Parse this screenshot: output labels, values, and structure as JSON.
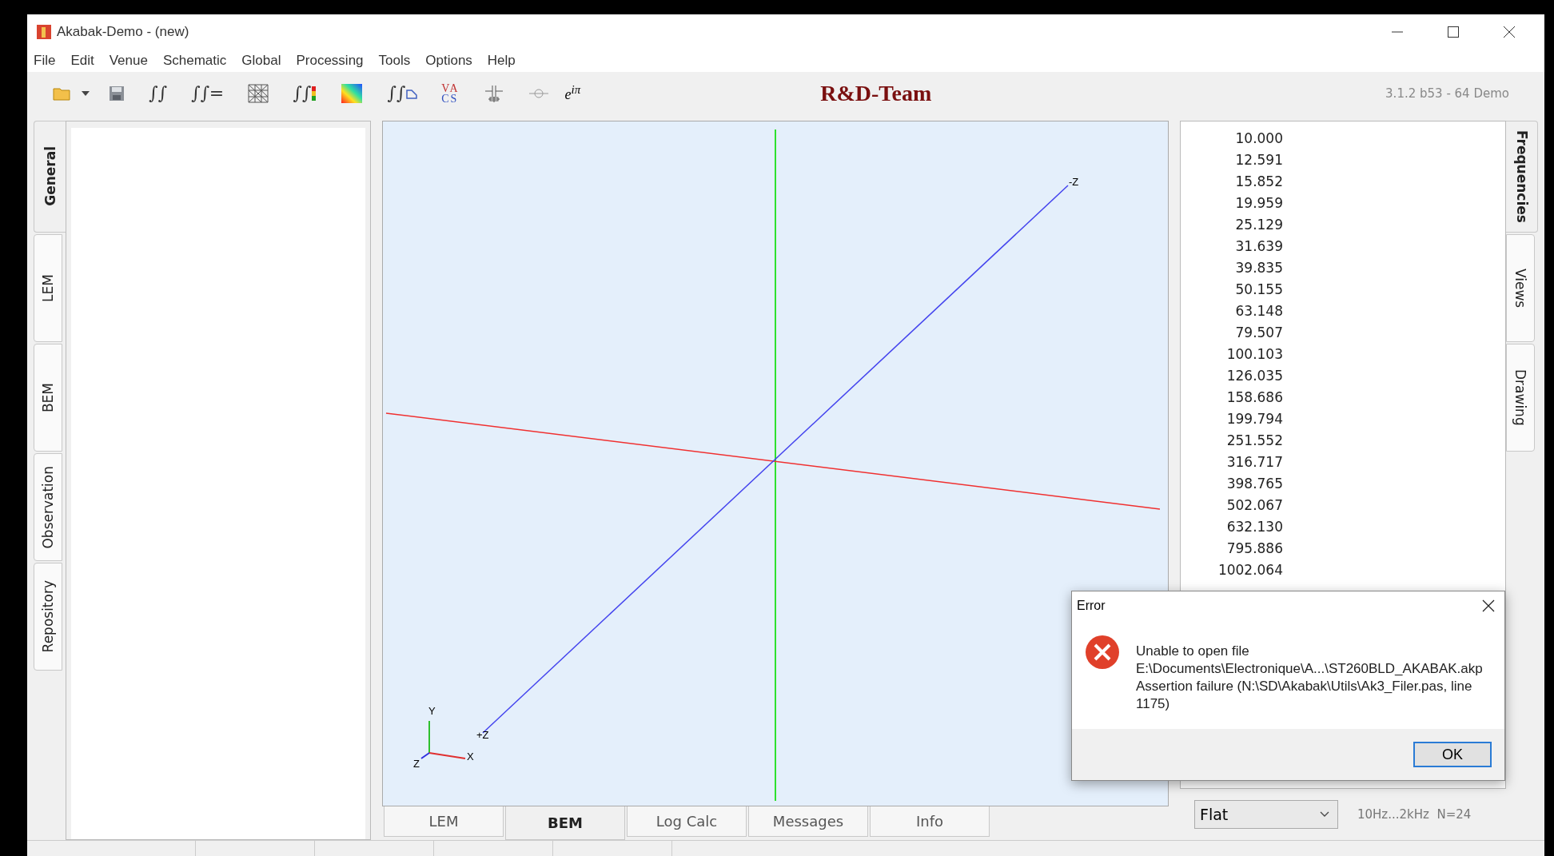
{
  "window": {
    "title": "Akabak-Demo - (new)"
  },
  "menu": [
    "File",
    "Edit",
    "Venue",
    "Schematic",
    "Global",
    "Processing",
    "Tools",
    "Options",
    "Help"
  ],
  "toolbar": [
    {
      "kind": "folder"
    },
    {
      "kind": "caret"
    },
    {
      "kind": "save"
    },
    {
      "kind": "glyph",
      "label": "∫∫"
    },
    {
      "kind": "glyph",
      "label": "∫∫="
    },
    {
      "kind": "mesh"
    },
    {
      "kind": "glyph-bars",
      "label": "∫∫"
    },
    {
      "kind": "gradient"
    },
    {
      "kind": "glyph-curve",
      "label": "∫∫"
    },
    {
      "kind": "vacs",
      "top": "VA",
      "bottom": "CS"
    },
    {
      "kind": "capacitor"
    },
    {
      "kind": "probe"
    },
    {
      "kind": "formula",
      "label": "e$^{iπ}$"
    }
  ],
  "brand": "R&D-Team",
  "version": "3.1.2 b53 - 64 Demo",
  "left_tabs": [
    {
      "label": "General",
      "selected": true
    },
    {
      "label": "LEM",
      "selected": false
    },
    {
      "label": "BEM",
      "selected": false
    },
    {
      "label": "Observation",
      "selected": false
    },
    {
      "label": "Repository",
      "selected": false
    }
  ],
  "viewport": {
    "axis_labels": [
      "-Z",
      "+Z"
    ],
    "triad_labels": [
      "Y",
      "X",
      "Z"
    ]
  },
  "bottom_tabs": [
    {
      "label": "LEM",
      "selected": false
    },
    {
      "label": "BEM",
      "selected": true
    },
    {
      "label": "Log Calc",
      "selected": false
    },
    {
      "label": "Messages",
      "selected": false
    },
    {
      "label": "Info",
      "selected": false
    }
  ],
  "frequencies": [
    "10.000",
    "12.591",
    "15.852",
    "19.959",
    "25.129",
    "31.639",
    "39.835",
    "50.155",
    "63.148",
    "79.507",
    "100.103",
    "126.035",
    "158.686",
    "199.794",
    "251.552",
    "316.717",
    "398.765",
    "502.067",
    "632.130",
    "795.886",
    "1002.064"
  ],
  "right_tabs": [
    {
      "label": "Frequencies",
      "selected": true
    },
    {
      "label": "Views",
      "selected": false
    },
    {
      "label": "Drawing",
      "selected": false
    }
  ],
  "response": {
    "value": "Flat",
    "range": "10Hz...2kHz  N=24"
  },
  "dialog": {
    "title": "Error",
    "message": [
      "Unable to open file",
      "E:\\Documents\\Electronique\\A...\\ST260BLD_AKABAK.akp",
      "Assertion failure (N:\\SD\\Akabak\\Utils\\Ak3_Filer.pas, line 1175)"
    ],
    "button": "OK"
  }
}
